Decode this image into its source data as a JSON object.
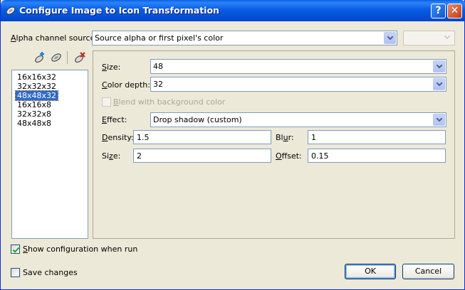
{
  "window": {
    "title": "Configure Image to Icon Transformation",
    "help_glyph": "?",
    "close_glyph": "✕"
  },
  "alpha": {
    "label_prefix": "",
    "label_accel": "A",
    "label_rest": "lpha channel source:",
    "value": "Source alpha or first pixel's color",
    "secondary_value": ""
  },
  "toolbar": {
    "add_icon": "add-format-icon",
    "edit_icon": "edit-format-icon",
    "delete_icon": "delete-format-icon"
  },
  "formats": {
    "items": [
      "16x16x32",
      "32x32x32",
      "48x48x32",
      "16x16x8",
      "32x32x8",
      "48x48x8"
    ],
    "selected_index": 2
  },
  "settings": {
    "size_accel": "S",
    "size_rest": "ize:",
    "size_value": "48",
    "depth_accel": "C",
    "depth_rest": "olor depth:",
    "depth_value": "32",
    "blend_accel": "B",
    "blend_rest": "lend with background color",
    "effect_accel": "E",
    "effect_rest": "ffect:",
    "effect_value": "Drop shadow (custom)",
    "density_accel": "D",
    "density_rest": "ensity:",
    "density_value": "1.5",
    "blur_pre": "Bl",
    "blur_accel": "u",
    "blur_rest": "r:",
    "blur_value": "1",
    "size2_pre": "Si",
    "size2_accel": "z",
    "size2_rest": "e:",
    "size2_value": "2",
    "offset_accel": "O",
    "offset_rest": "ffset:",
    "offset_value": "0.15"
  },
  "footer": {
    "show_config_accel": "S",
    "show_config_rest": "how configuration when run",
    "show_config_checked": true,
    "save_changes": "Save changes",
    "save_changes_checked": false,
    "ok": "OK",
    "cancel": "Cancel"
  },
  "colors": {
    "titlebar": "#0a5ce4",
    "dialog_bg": "#ece9d8",
    "selection": "#316ac5",
    "border": "#7f9db9"
  }
}
